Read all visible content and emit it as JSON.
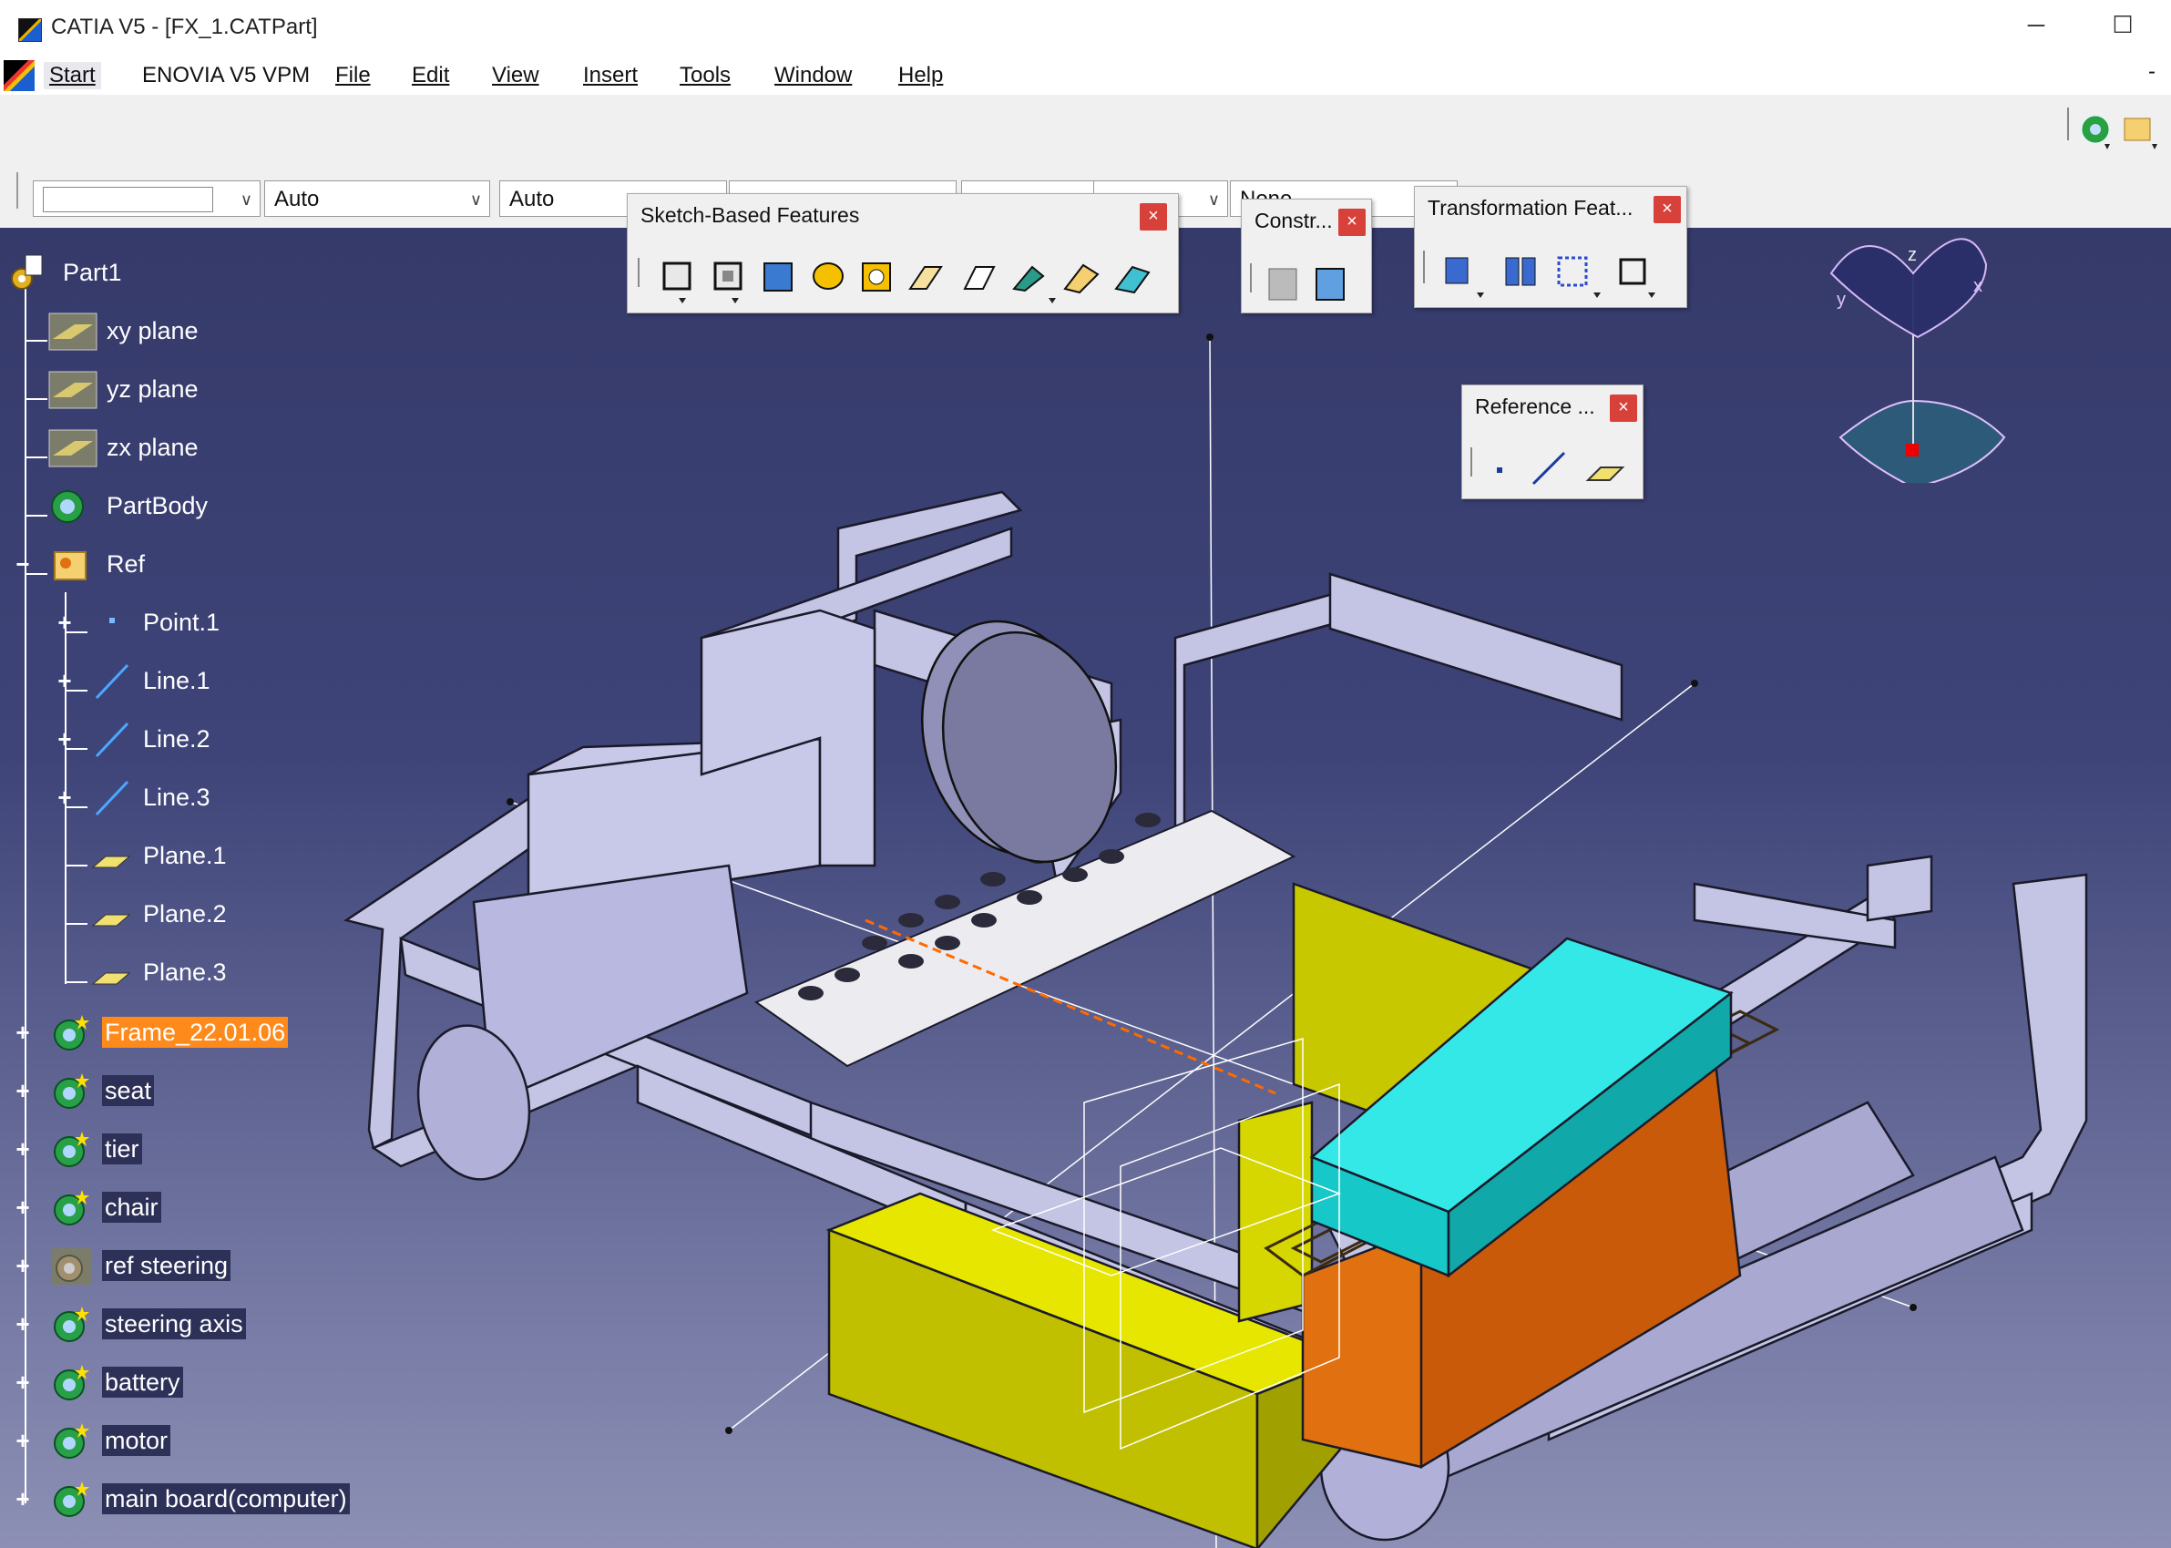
{
  "window": {
    "title": "CATIA V5 - [FX_1.CATPart]",
    "minimize": "─",
    "maximize": "☐",
    "scroll_minus": "-"
  },
  "menu": [
    {
      "label": "Start",
      "id": "start"
    },
    {
      "label": "ENOVIA V5 VPM",
      "id": "enovia"
    },
    {
      "label": "File",
      "id": "file"
    },
    {
      "label": "Edit",
      "id": "edit"
    },
    {
      "label": "View",
      "id": "view"
    },
    {
      "label": "Insert",
      "id": "insert"
    },
    {
      "label": "Tools",
      "id": "tools"
    },
    {
      "label": "Window",
      "id": "window"
    },
    {
      "label": "Help",
      "id": "help"
    }
  ],
  "combos": {
    "first": "",
    "second": "Auto",
    "third": "Auto",
    "last": "None"
  },
  "panels": {
    "sketch": {
      "title": "Sketch-Based Features"
    },
    "constraints": {
      "title": "Constr..."
    },
    "transformation": {
      "title": "Transformation Feat..."
    },
    "reference": {
      "title": "Reference ..."
    },
    "close": "×"
  },
  "compass": {
    "x": "x",
    "y": "y",
    "z": "z"
  },
  "tree": [
    {
      "label": "Part1",
      "icon": "part-icon"
    },
    {
      "label": "xy plane",
      "icon": "plane-icon"
    },
    {
      "label": "yz plane",
      "icon": "plane-icon"
    },
    {
      "label": "zx plane",
      "icon": "plane-icon"
    },
    {
      "label": "PartBody",
      "icon": "body-icon"
    },
    {
      "label": "Ref",
      "icon": "geometrical-set-icon"
    },
    {
      "label": "Point.1",
      "icon": "point-icon"
    },
    {
      "label": "Line.1",
      "icon": "line-icon"
    },
    {
      "label": "Line.2",
      "icon": "line-icon"
    },
    {
      "label": "Line.3",
      "icon": "line-icon"
    },
    {
      "label": "Plane.1",
      "icon": "ref-plane-icon"
    },
    {
      "label": "Plane.2",
      "icon": "ref-plane-icon"
    },
    {
      "label": "Plane.3",
      "icon": "ref-plane-icon"
    },
    {
      "label": "Frame_22.01.06",
      "icon": "body-icon",
      "selected": true
    },
    {
      "label": "seat",
      "icon": "body-icon"
    },
    {
      "label": "tier",
      "icon": "body-icon"
    },
    {
      "label": "chair",
      "icon": "body-icon"
    },
    {
      "label": "ref steering",
      "icon": "hidden-body-icon"
    },
    {
      "label": "steering axis",
      "icon": "body-icon"
    },
    {
      "label": "battery",
      "icon": "body-icon"
    },
    {
      "label": "motor",
      "icon": "body-icon"
    },
    {
      "label": "main board(computer)",
      "icon": "body-icon"
    }
  ],
  "colors": {
    "selected": "#ff8a1c",
    "viewport_top": "#353a6a",
    "part_lavender": "#c4c4e4",
    "battery_cyan": "#17d4d4",
    "motor_orange": "#c85a0a",
    "yellow_box": "#d6d600",
    "close_red": "#d8403a"
  }
}
